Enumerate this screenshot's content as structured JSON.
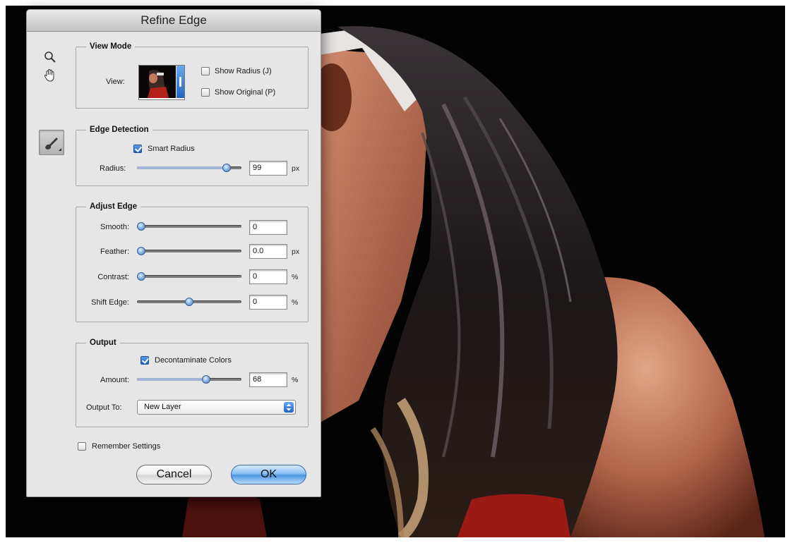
{
  "dialog": {
    "title": "Refine Edge"
  },
  "tools": {
    "zoom": "zoom-icon",
    "hand": "hand-icon",
    "refine_radius": "refine-radius-brush-icon"
  },
  "view_mode": {
    "legend": "View Mode",
    "view_label": "View:",
    "show_radius": {
      "label": "Show Radius (J)",
      "checked": false
    },
    "show_original": {
      "label": "Show Original (P)",
      "checked": false
    }
  },
  "edge_detection": {
    "legend": "Edge Detection",
    "smart_radius": {
      "label": "Smart Radius",
      "checked": true
    },
    "radius": {
      "label": "Radius:",
      "value": "99",
      "unit": "px",
      "slider_fraction": 0.89
    }
  },
  "adjust_edge": {
    "legend": "Adjust Edge",
    "smooth": {
      "label": "Smooth:",
      "value": "0",
      "unit": "",
      "slider_fraction": 0.0
    },
    "feather": {
      "label": "Feather:",
      "value": "0.0",
      "unit": "px",
      "slider_fraction": 0.0
    },
    "contrast": {
      "label": "Contrast:",
      "value": "0",
      "unit": "%",
      "slider_fraction": 0.0
    },
    "shift_edge": {
      "label": "Shift Edge:",
      "value": "0",
      "unit": "%",
      "slider_fraction": 0.5
    }
  },
  "output": {
    "legend": "Output",
    "decontaminate": {
      "label": "Decontaminate Colors",
      "checked": true
    },
    "amount": {
      "label": "Amount:",
      "value": "68",
      "unit": "%",
      "slider_fraction": 0.68
    },
    "output_to": {
      "label": "Output To:",
      "value": "New Layer"
    }
  },
  "remember": {
    "label": "Remember Settings",
    "checked": false
  },
  "buttons": {
    "cancel": "Cancel",
    "ok": "OK"
  },
  "colors": {
    "accent": "#3f86db",
    "dialog_bg": "#e6e6e6",
    "canvas_bg": "#040303"
  }
}
